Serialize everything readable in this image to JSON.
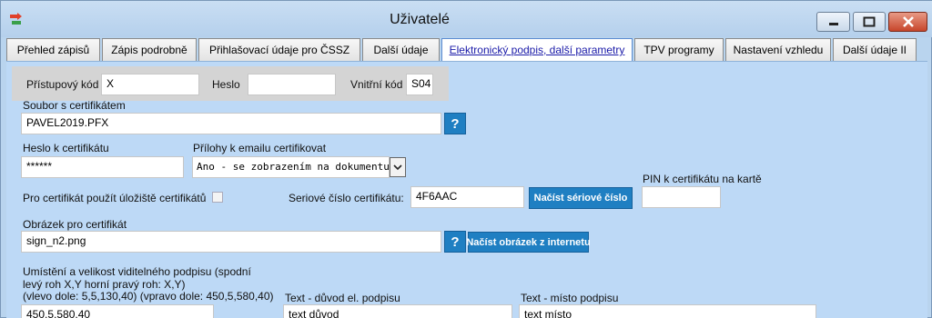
{
  "window": {
    "title": "Uživatelé"
  },
  "tabs": [
    {
      "label": "Přehled zápisů"
    },
    {
      "label": "Zápis podrobně"
    },
    {
      "label": "Přihlašovací údaje pro ČSSZ"
    },
    {
      "label": "Další údaje"
    },
    {
      "label": "Elektronický podpis, další parametry"
    },
    {
      "label": "TPV programy"
    },
    {
      "label": "Nastavení vzhledu"
    },
    {
      "label": "Další údaje II"
    }
  ],
  "access": {
    "access_code_label": "Přístupový kód",
    "access_code_value": "X",
    "password_label": "Heslo",
    "password_value": "",
    "internal_code_label": "Vnitřní kód",
    "internal_code_value": "S04"
  },
  "certificate": {
    "file_label": "Soubor s certifikátem",
    "file_value": "PAVEL2019.PFX",
    "help": "?",
    "password_label": "Heslo k certifikátu",
    "password_value": "******",
    "attach_label": "Přílohy k emailu certifikovat",
    "attach_value": "Ano - se zobrazením na dokumentu",
    "pin_label": "PIN k certifikátu na kartě",
    "pin_value": "",
    "use_store_label": "Pro certifikát použít úložiště certifikátů",
    "serial_label": "Seriové číslo certifikátu:",
    "serial_value": "4F6AAC",
    "load_serial_button": "Načíst sériové číslo",
    "image_label": "Obrázek pro certifikát",
    "image_value": "sign_n2.png",
    "load_image_button": "Načíst obrázek z internetu"
  },
  "signature": {
    "position_label_line1": "Umístění a velikost viditelného podpisu (spodní",
    "position_label_line2": "levý roh X,Y  horní pravý roh: X,Y)",
    "position_label_line3": "(vlevo dole: 5,5,130,40)     (vpravo dole: 450,5,580,40)",
    "position_value": "450,5,580,40",
    "reason_label": "Text - důvod el. podpisu",
    "reason_value": "text důvod",
    "location_label": "Text - místo podpisu",
    "location_value": "text místo"
  }
}
